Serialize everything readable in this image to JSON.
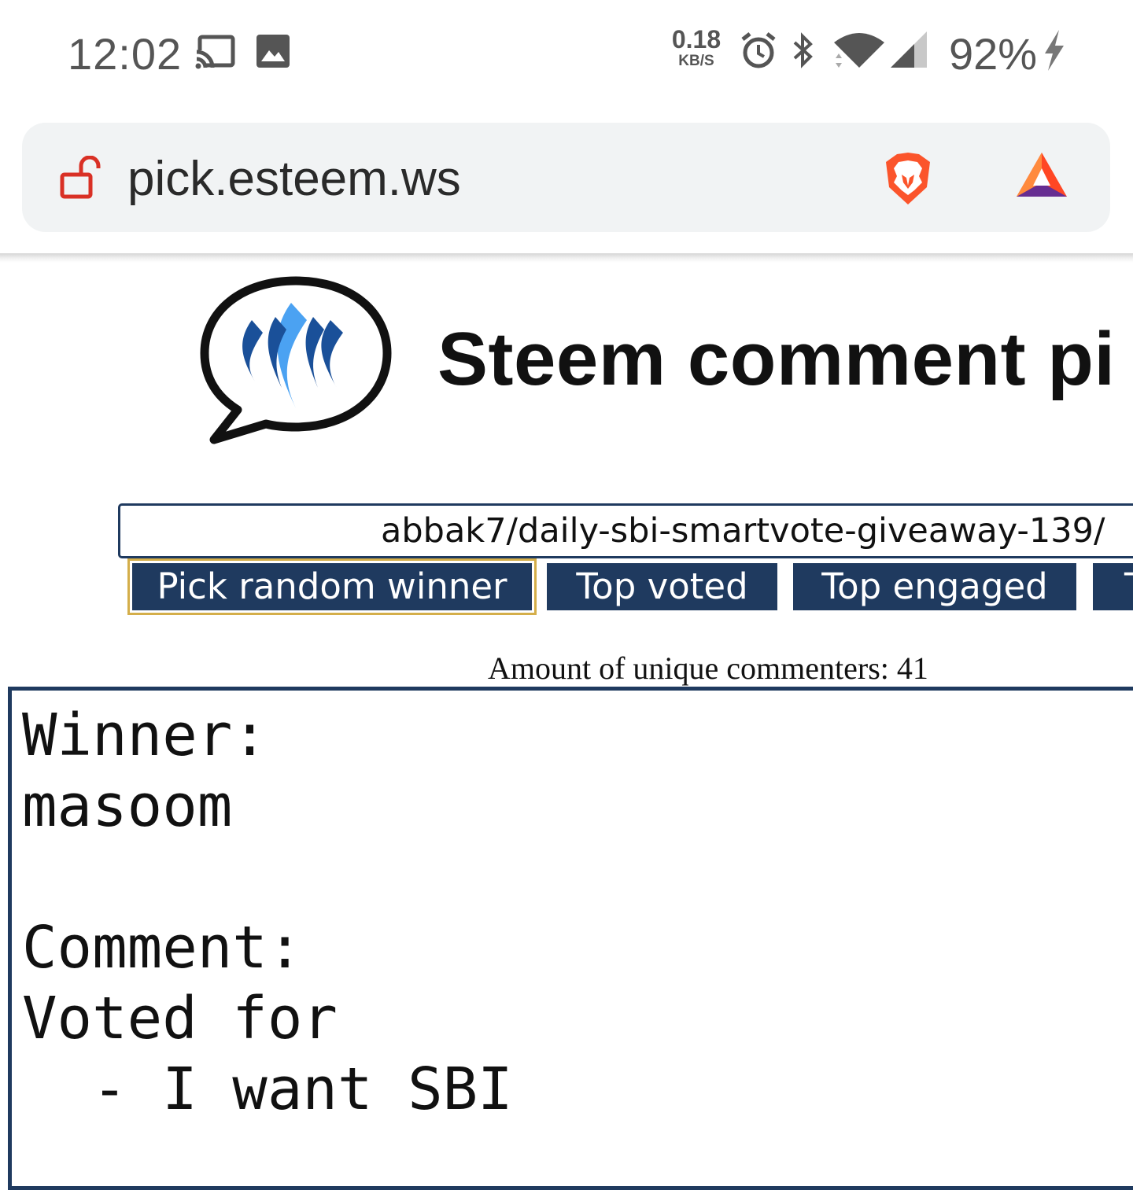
{
  "status_bar": {
    "time": "12:02",
    "network_speed": "0.18",
    "network_speed_unit": "KB/S",
    "battery": "92%",
    "icons": [
      "cast-icon",
      "image-icon",
      "alarm-icon",
      "bluetooth-icon",
      "wifi-icon",
      "cell-signal-icon",
      "charging-icon"
    ]
  },
  "browser": {
    "url": "pick.esteem.ws",
    "icons": [
      "unlock-icon",
      "brave-shield-icon",
      "bat-rewards-icon"
    ]
  },
  "page": {
    "title": "Steem comment pi",
    "post_input_value": "abbak7/daily-sbi-smartvote-giveaway-139/",
    "buttons": {
      "pick_random": "Pick random winner",
      "top_voted": "Top voted",
      "top_engaged": "Top engaged",
      "more": "T"
    },
    "unique_commenters": "Amount of unique commenters: 41",
    "result": {
      "winner_label": "Winner:",
      "winner_name": "masoom",
      "comment_label": "Comment:",
      "comment_line1": "Voted for",
      "comment_line2": "  - I want SBI"
    }
  },
  "colors": {
    "accent": "#1f3a5f",
    "button_focus_outline": "#d4ae4a",
    "unlock_red": "#d93025",
    "brave_orange": "#fb542b"
  }
}
